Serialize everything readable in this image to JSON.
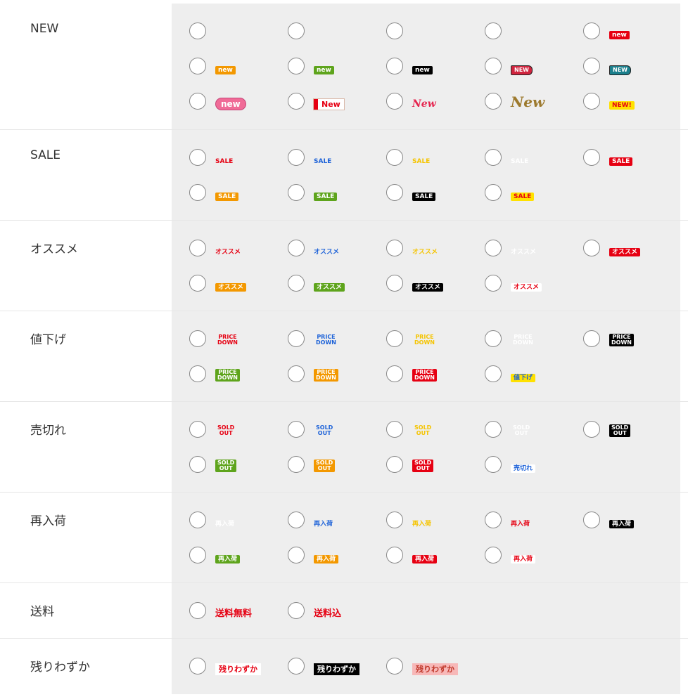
{
  "categories": [
    {
      "label": "NEW",
      "icons": [
        {
          "name": "new-blank-1",
          "text": "",
          "style": "blank"
        },
        {
          "name": "new-blank-2",
          "text": "",
          "style": "blank"
        },
        {
          "name": "new-blank-3",
          "text": "",
          "style": "blank"
        },
        {
          "name": "new-blank-4",
          "text": "",
          "style": "blank"
        },
        {
          "name": "new-red",
          "text": "new",
          "style": "solid",
          "bg": "#e60012",
          "fg": "#ffffff"
        },
        {
          "name": "new-orange",
          "text": "new",
          "style": "solid",
          "bg": "#f39800",
          "fg": "#ffffff"
        },
        {
          "name": "new-green",
          "text": "new",
          "style": "solid",
          "bg": "#5ea41c",
          "fg": "#ffffff"
        },
        {
          "name": "new-black",
          "text": "new",
          "style": "solid",
          "bg": "#000000",
          "fg": "#ffffff"
        },
        {
          "name": "new-tag-pink",
          "text": "NEW",
          "style": "tag",
          "bg": "#d0243e",
          "fg": "#ffffff"
        },
        {
          "name": "new-tag-teal",
          "text": "NEW",
          "style": "tag",
          "bg": "#1b7f8c",
          "fg": "#ffffff"
        },
        {
          "name": "new-pink-pill",
          "text": "new",
          "style": "pill",
          "bg": "#f06b97",
          "fg": "#ffffff"
        },
        {
          "name": "new-flag",
          "text": "New",
          "style": "flag",
          "bg": "#ffffff",
          "fg": "#e60012"
        },
        {
          "name": "new-red-script",
          "text": "New",
          "style": "script",
          "fg": "#e5244e"
        },
        {
          "name": "new-gold-script",
          "text": "New",
          "style": "script-gold",
          "fg": "#9d7a2e"
        },
        {
          "name": "new-yellow-bang",
          "text": "NEW!",
          "style": "solid",
          "bg": "#ffe100",
          "fg": "#e60012"
        }
      ]
    },
    {
      "label": "SALE",
      "icons": [
        {
          "name": "sale-red-text",
          "text": "SALE",
          "style": "text",
          "fg": "#e60012"
        },
        {
          "name": "sale-blue-text",
          "text": "SALE",
          "style": "text",
          "fg": "#1d62d8"
        },
        {
          "name": "sale-yellow-text",
          "text": "SALE",
          "style": "text",
          "fg": "#f5c400"
        },
        {
          "name": "sale-white-text",
          "text": "SALE",
          "style": "text",
          "fg": "#ffffff"
        },
        {
          "name": "sale-red",
          "text": "SALE",
          "style": "solid",
          "bg": "#e60012",
          "fg": "#ffffff"
        },
        {
          "name": "sale-orange",
          "text": "SALE",
          "style": "solid",
          "bg": "#f39800",
          "fg": "#ffffff"
        },
        {
          "name": "sale-green",
          "text": "SALE",
          "style": "solid",
          "bg": "#5ea41c",
          "fg": "#ffffff"
        },
        {
          "name": "sale-black",
          "text": "SALE",
          "style": "solid",
          "bg": "#000000",
          "fg": "#ffffff"
        },
        {
          "name": "sale-yellow",
          "text": "SALE",
          "style": "solid",
          "bg": "#ffe100",
          "fg": "#e60012"
        }
      ]
    },
    {
      "label": "オススメ",
      "icons": [
        {
          "name": "osusume-red-text",
          "text": "オススメ",
          "style": "text",
          "fg": "#e60012"
        },
        {
          "name": "osusume-blue-text",
          "text": "オススメ",
          "style": "text",
          "fg": "#1d62d8"
        },
        {
          "name": "osusume-yellow-text",
          "text": "オススメ",
          "style": "text",
          "fg": "#f5c400"
        },
        {
          "name": "osusume-white-text",
          "text": "オススメ",
          "style": "text",
          "fg": "#ffffff"
        },
        {
          "name": "osusume-red",
          "text": "オススメ",
          "style": "solid",
          "bg": "#e60012",
          "fg": "#ffffff"
        },
        {
          "name": "osusume-orange",
          "text": "オススメ",
          "style": "solid",
          "bg": "#f39800",
          "fg": "#ffffff"
        },
        {
          "name": "osusume-green",
          "text": "オススメ",
          "style": "solid",
          "bg": "#5ea41c",
          "fg": "#ffffff"
        },
        {
          "name": "osusume-black",
          "text": "オススメ",
          "style": "solid",
          "bg": "#000000",
          "fg": "#ffffff"
        },
        {
          "name": "osusume-white",
          "text": "オススメ",
          "style": "solid",
          "bg": "#ffffff",
          "fg": "#e60012"
        }
      ]
    },
    {
      "label": "値下げ",
      "icons": [
        {
          "name": "pricedown-red-text",
          "text": "PRICE DOWN",
          "style": "stack-text",
          "fg": "#e60012"
        },
        {
          "name": "pricedown-blue-text",
          "text": "PRICE DOWN",
          "style": "stack-text",
          "fg": "#1d62d8"
        },
        {
          "name": "pricedown-yellow-text",
          "text": "PRICE DOWN",
          "style": "stack-text",
          "fg": "#f5c400"
        },
        {
          "name": "pricedown-white-text",
          "text": "PRICE DOWN",
          "style": "stack-text",
          "fg": "#ffffff"
        },
        {
          "name": "pricedown-black",
          "text": "PRICE DOWN",
          "style": "stack",
          "bg": "#000000",
          "fg": "#ffffff"
        },
        {
          "name": "pricedown-green",
          "text": "PRICE DOWN",
          "style": "stack",
          "bg": "#5ea41c",
          "fg": "#ffffff"
        },
        {
          "name": "pricedown-orange",
          "text": "PRICE DOWN",
          "style": "stack",
          "bg": "#f39800",
          "fg": "#ffffff"
        },
        {
          "name": "pricedown-red",
          "text": "PRICE DOWN",
          "style": "stack",
          "bg": "#e60012",
          "fg": "#ffffff"
        },
        {
          "name": "neasage-yellow",
          "text": "値下げ",
          "style": "solid",
          "bg": "#ffe100",
          "fg": "#1d62d8"
        }
      ]
    },
    {
      "label": "売切れ",
      "icons": [
        {
          "name": "soldout-red-text",
          "text": "SOLD OUT",
          "style": "stack-text",
          "fg": "#e60012"
        },
        {
          "name": "soldout-blue-text",
          "text": "SOLD OUT",
          "style": "stack-text",
          "fg": "#1d62d8"
        },
        {
          "name": "soldout-yellow-text",
          "text": "SOLD OUT",
          "style": "stack-text",
          "fg": "#f5c400"
        },
        {
          "name": "soldout-white-text",
          "text": "SOLD OUT",
          "style": "stack-text",
          "fg": "#ffffff"
        },
        {
          "name": "soldout-black",
          "text": "SOLD OUT",
          "style": "stack",
          "bg": "#000000",
          "fg": "#ffffff"
        },
        {
          "name": "soldout-green",
          "text": "SOLD OUT",
          "style": "stack",
          "bg": "#5ea41c",
          "fg": "#ffffff"
        },
        {
          "name": "soldout-orange",
          "text": "SOLD OUT",
          "style": "stack",
          "bg": "#f39800",
          "fg": "#ffffff"
        },
        {
          "name": "soldout-red",
          "text": "SOLD OUT",
          "style": "stack",
          "bg": "#e60012",
          "fg": "#ffffff"
        },
        {
          "name": "urikire-white",
          "text": "売切れ",
          "style": "solid",
          "bg": "#ffffff",
          "fg": "#1d62d8"
        }
      ]
    },
    {
      "label": "再入荷",
      "icons": [
        {
          "name": "sainyuka-white-text",
          "text": "再入荷",
          "style": "text",
          "fg": "#ffffff"
        },
        {
          "name": "sainyuka-blue-text",
          "text": "再入荷",
          "style": "text",
          "fg": "#1d62d8"
        },
        {
          "name": "sainyuka-yellow-text",
          "text": "再入荷",
          "style": "text",
          "fg": "#f5c400"
        },
        {
          "name": "sainyuka-red-text",
          "text": "再入荷",
          "style": "text",
          "fg": "#e60012"
        },
        {
          "name": "sainyuka-black",
          "text": "再入荷",
          "style": "solid",
          "bg": "#000000",
          "fg": "#ffffff"
        },
        {
          "name": "sainyuka-green",
          "text": "再入荷",
          "style": "solid",
          "bg": "#5ea41c",
          "fg": "#ffffff"
        },
        {
          "name": "sainyuka-orange",
          "text": "再入荷",
          "style": "solid",
          "bg": "#f39800",
          "fg": "#ffffff"
        },
        {
          "name": "sainyuka-red",
          "text": "再入荷",
          "style": "solid",
          "bg": "#e60012",
          "fg": "#ffffff"
        },
        {
          "name": "sainyuka-white",
          "text": "再入荷",
          "style": "solid",
          "bg": "#ffffff",
          "fg": "#e60012"
        }
      ]
    },
    {
      "label": "送料",
      "icons": [
        {
          "name": "soryo-muryo",
          "text": "送料無料",
          "style": "text-big",
          "fg": "#e60012"
        },
        {
          "name": "soryo-komi",
          "text": "送料込",
          "style": "text-big",
          "fg": "#e60012"
        }
      ]
    },
    {
      "label": "残りわずか",
      "icons": [
        {
          "name": "nokori-white",
          "text": "残りわずか",
          "style": "solid-big",
          "bg": "#ffffff",
          "fg": "#e60012"
        },
        {
          "name": "nokori-black",
          "text": "残りわずか",
          "style": "solid-big",
          "bg": "#000000",
          "fg": "#ffffff"
        },
        {
          "name": "nokori-pink",
          "text": "残りわずか",
          "style": "solid-big",
          "bg": "#f7b8b8",
          "fg": "#c0392b"
        }
      ]
    }
  ]
}
